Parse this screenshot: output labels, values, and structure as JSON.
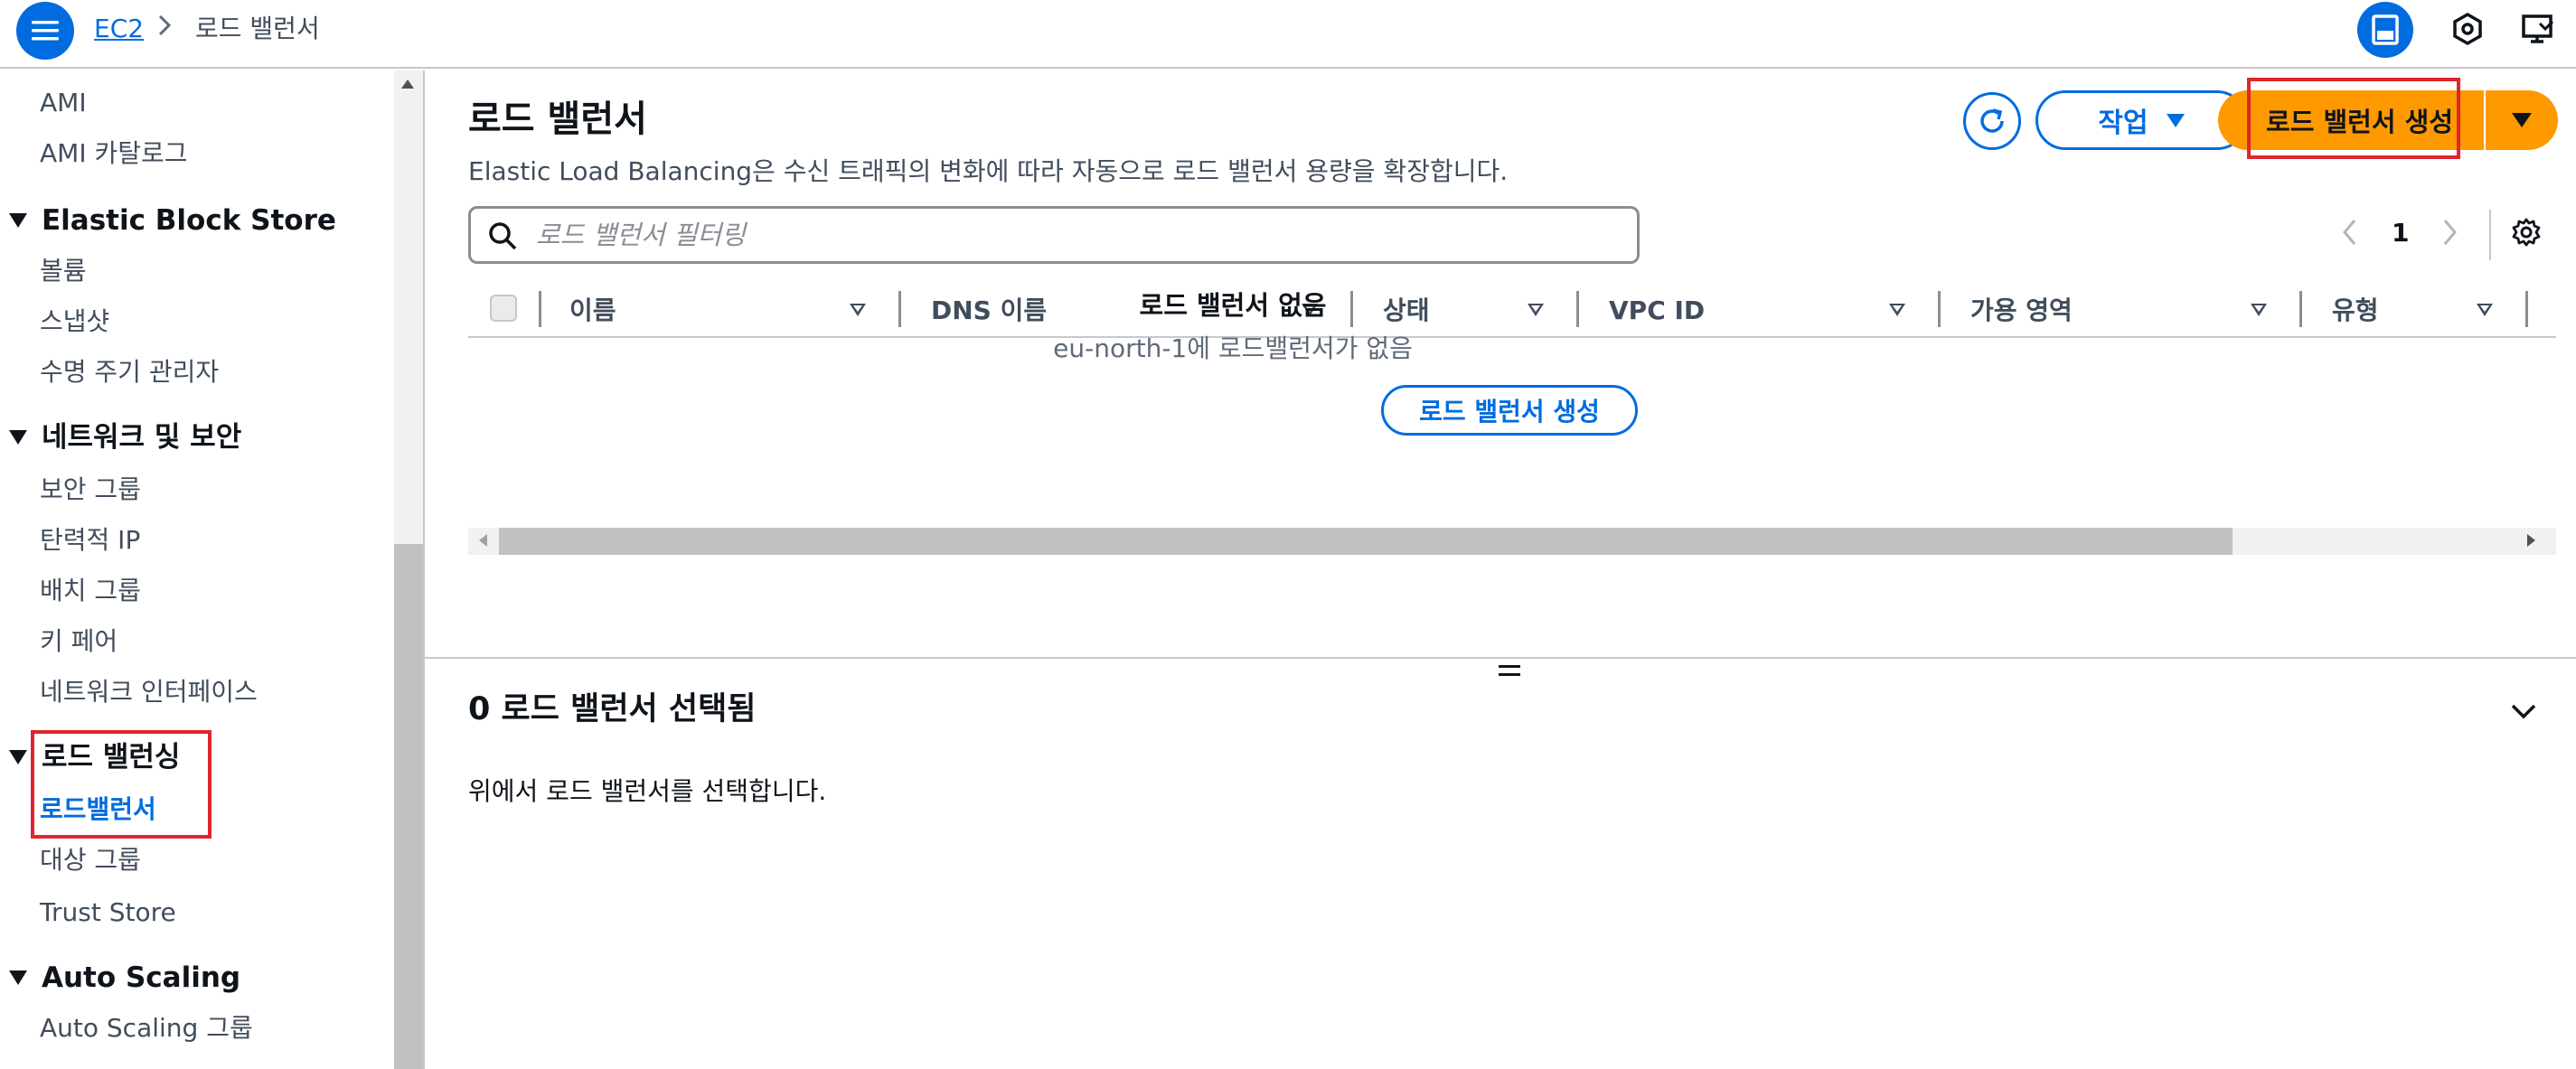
{
  "topbar": {
    "breadcrumb_root": "EC2",
    "breadcrumb_current": "로드 밸런서"
  },
  "sidebar": {
    "items_top": [
      "AMI",
      "AMI 카탈로그"
    ],
    "sections": [
      {
        "heading": "Elastic Block Store",
        "items": [
          "볼륨",
          "스냅샷",
          "수명 주기 관리자"
        ]
      },
      {
        "heading": "네트워크 및 보안",
        "items": [
          "보안 그룹",
          "탄력적 IP",
          "배치 그룹",
          "키 페어",
          "네트워크 인터페이스"
        ]
      },
      {
        "heading": "로드 밸런싱",
        "items": [
          "로드밸런서",
          "대상 그룹",
          "Trust Store"
        ]
      },
      {
        "heading": "Auto Scaling",
        "items": [
          "Auto Scaling 그룹"
        ]
      }
    ],
    "active_item": "로드밸런서"
  },
  "main": {
    "title": "로드 밸런서",
    "description": "Elastic Load Balancing은 수신 트래픽의 변화에 따라 자동으로 로드 밸런서 용량을 확장합니다.",
    "actions_label": "작업",
    "create_label": "로드 밸런서 생성",
    "search_placeholder": "로드 밸런서 필터링",
    "page_number": "1",
    "columns": [
      "이름",
      "DNS 이름",
      "상태",
      "VPC ID",
      "가용 영역",
      "유형"
    ],
    "empty_title": "로드 밸런서 없음",
    "empty_subtitle": "eu-north-1에 로드밸런서가 없음",
    "empty_button": "로드 밸런서 생성"
  },
  "details": {
    "title": "0 로드 밸런서 선택됨",
    "text": "위에서 로드 밸런서를 선택합니다."
  },
  "colors": {
    "accent": "#006ce0",
    "primary_button": "#ff9900",
    "highlight": "#e0252f"
  }
}
